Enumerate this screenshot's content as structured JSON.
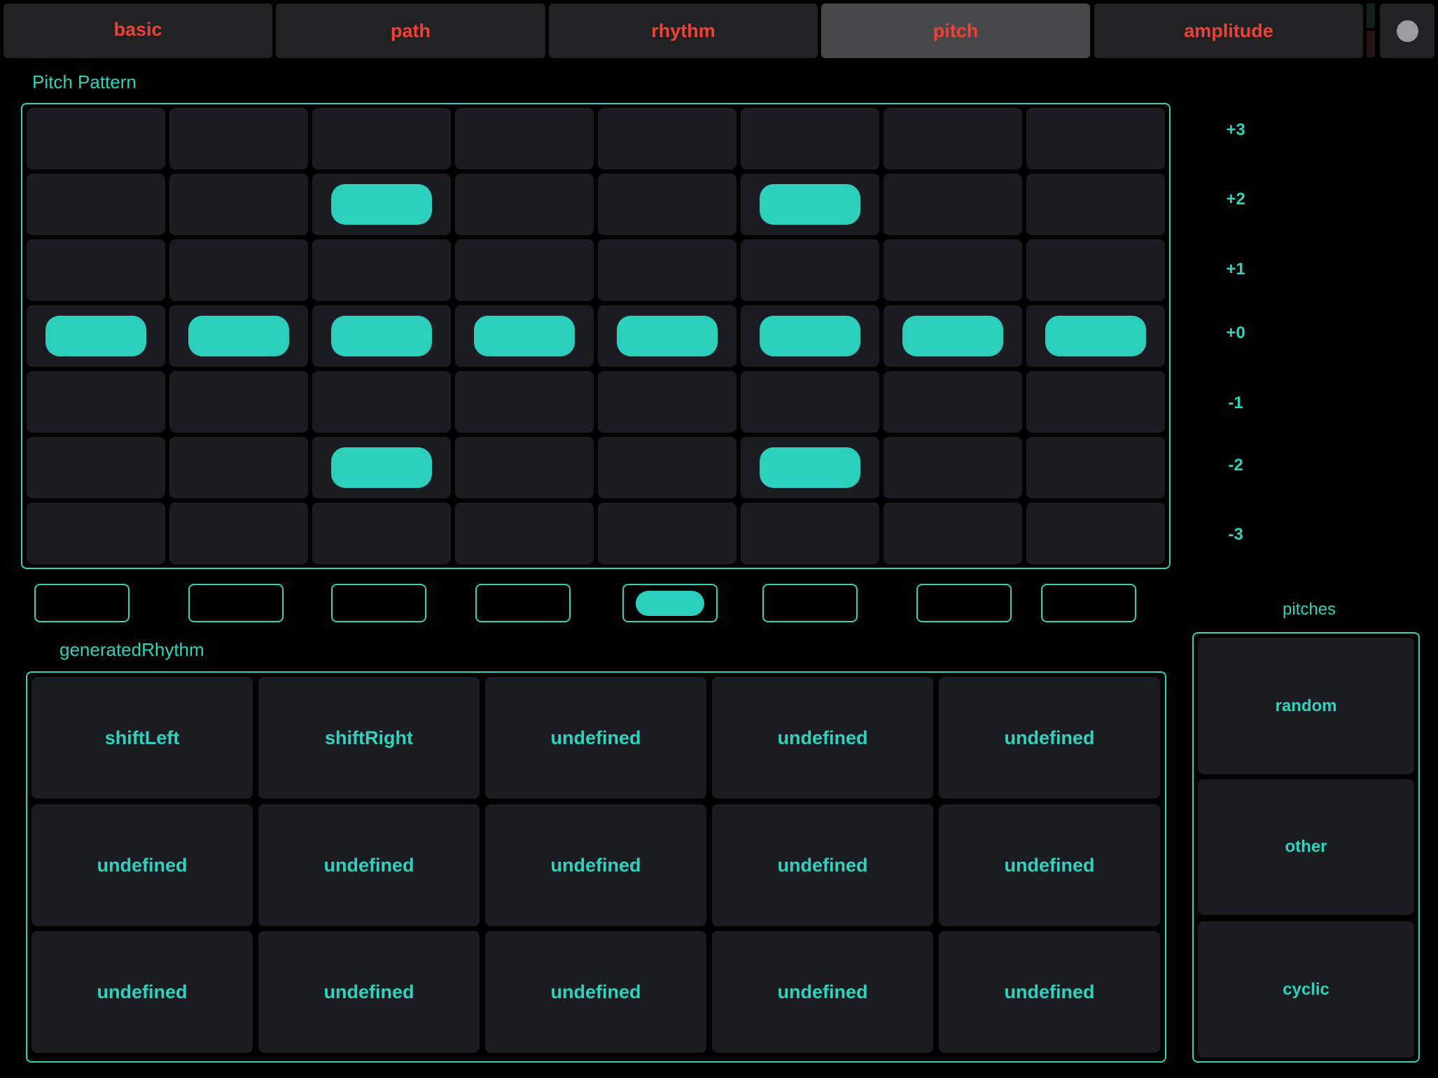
{
  "tabs": [
    {
      "label": "basic",
      "active": false
    },
    {
      "label": "path",
      "active": false
    },
    {
      "label": "rhythm",
      "active": false
    },
    {
      "label": "pitch",
      "active": true
    },
    {
      "label": "amplitude",
      "active": false
    }
  ],
  "pitch_pattern": {
    "title": "Pitch Pattern",
    "row_labels": [
      "+3",
      "+2",
      "+1",
      "+0",
      "-1",
      "-2",
      "-3"
    ],
    "active_cells": [
      {
        "col": 0,
        "row": "+0"
      },
      {
        "col": 1,
        "row": "+0"
      },
      {
        "col": 2,
        "row": "+2"
      },
      {
        "col": 2,
        "row": "+0"
      },
      {
        "col": 2,
        "row": "-2"
      },
      {
        "col": 3,
        "row": "+0"
      },
      {
        "col": 4,
        "row": "+0"
      },
      {
        "col": 5,
        "row": "+2"
      },
      {
        "col": 5,
        "row": "+0"
      },
      {
        "col": 5,
        "row": "-2"
      },
      {
        "col": 6,
        "row": "+0"
      },
      {
        "col": 7,
        "row": "+0"
      }
    ]
  },
  "step_toggles": [
    false,
    false,
    false,
    false,
    true,
    false,
    false,
    false
  ],
  "generated_rhythm": {
    "title": "generatedRhythm",
    "buttons": [
      [
        "shiftLeft",
        "shiftRight",
        "undefined",
        "undefined",
        "undefined"
      ],
      [
        "undefined",
        "undefined",
        "undefined",
        "undefined",
        "undefined"
      ],
      [
        "undefined",
        "undefined",
        "undefined",
        "undefined",
        "undefined"
      ]
    ]
  },
  "pitches": {
    "title": "pitches",
    "buttons": [
      "random",
      "other",
      "cyclic"
    ]
  },
  "colors": {
    "accent": "#2dd3bd",
    "tab_text": "#ee4137",
    "cell_bg": "#1b1b22",
    "tab_bg": "#222224",
    "tab_active_bg": "#48484b"
  }
}
